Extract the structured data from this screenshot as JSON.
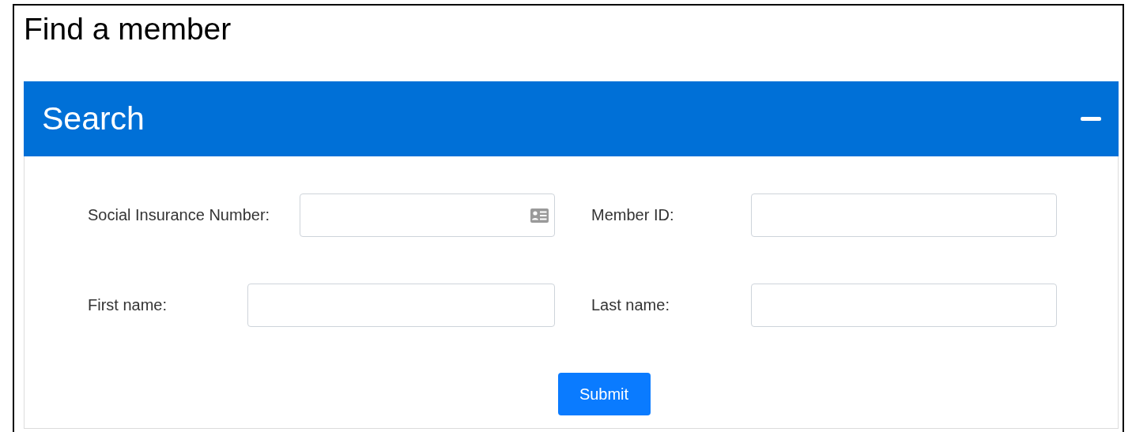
{
  "page_title": "Find a member",
  "panel": {
    "title": "Search",
    "expanded": true,
    "fields": [
      {
        "label": "Social Insurance Number:",
        "kind": "id"
      },
      {
        "label": "Member ID:",
        "kind": "text"
      },
      {
        "label": "First name:",
        "kind": "text"
      },
      {
        "label": "Last name:",
        "kind": "text"
      }
    ],
    "submit": "Submit"
  }
}
